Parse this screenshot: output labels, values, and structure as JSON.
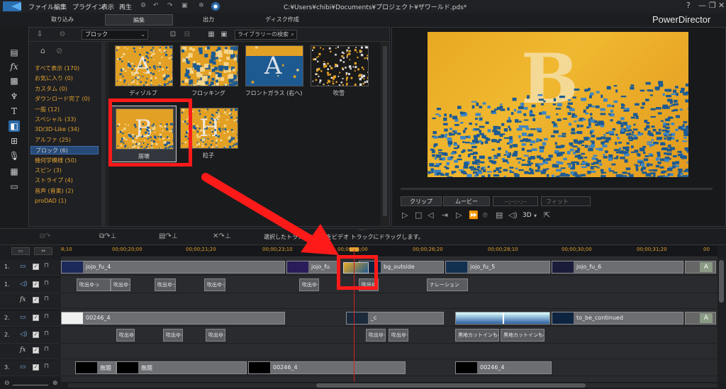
{
  "window": {
    "title": "C:¥Users¥chibi¥Documents¥プロジェクト¥ザワールド.pds*",
    "brand": "PowerDirector",
    "menus": [
      "ファイル",
      "編集",
      "プラグイン",
      "表示",
      "再生"
    ],
    "help": "?",
    "minimize": "—",
    "restore": "❐",
    "close": "✕"
  },
  "tabs": [
    "取り込み",
    "編集",
    "出力",
    "ディスク作成"
  ],
  "active_tab": "編集",
  "library": {
    "category_dropdown": "ブロック",
    "search_placeholder": "ライブラリーの検索",
    "categories": [
      {
        "label": "すべて表示 (170)",
        "selected": false
      },
      {
        "label": "お気に入り (0)",
        "selected": false
      },
      {
        "label": "カスタム (0)",
        "selected": false
      },
      {
        "label": "ダウンロード完了 (0)",
        "selected": false
      },
      {
        "label": "一般 (12)",
        "selected": false
      },
      {
        "label": "スペシャル (33)",
        "selected": false
      },
      {
        "label": "3D/3D-Like (34)",
        "selected": false
      },
      {
        "label": "アルファ (25)",
        "selected": false
      },
      {
        "label": "ブロック (6)",
        "selected": true
      },
      {
        "label": "幾何学模様 (50)",
        "selected": false
      },
      {
        "label": "スピン (3)",
        "selected": false
      },
      {
        "label": "ストライプ (4)",
        "selected": false
      },
      {
        "label": "音声 (音楽) (2)",
        "selected": false
      },
      {
        "label": "proDAD (1)",
        "selected": false
      }
    ],
    "transitions": [
      {
        "label": "ディゾルブ",
        "style": "dissolve",
        "glyph": "A"
      },
      {
        "label": "フロッキング",
        "style": "flocking",
        "glyph": ""
      },
      {
        "label": "フロントガラス (右へ)",
        "style": "windshield",
        "glyph": "A"
      },
      {
        "label": "吹雪",
        "style": "blizzard",
        "glyph": ""
      },
      {
        "label": "崩壊",
        "style": "collapse",
        "glyph": "B"
      },
      {
        "label": "粒子",
        "style": "particle",
        "glyph": "H"
      }
    ],
    "selected_transition": "崩壊"
  },
  "preview": {
    "glyph": "B",
    "clip_tab": "クリップ",
    "movie_tab": "ムービー",
    "timecode": "--;--;--;--",
    "fit": "フィット",
    "mode_3d": "3D"
  },
  "timeline": {
    "hint": "選択したトランジションをビデオ トラックにドラッグします。",
    "ruler_ticks": [
      "8;10",
      "00;00;20;00",
      "00;00;21;20",
      "00;00;23;10",
      "00;00;25;00",
      "00;00;26;20",
      "00;00;28;10",
      "00;00;30;00",
      "00;00;31;20",
      "00"
    ],
    "tracks": [
      {
        "num": "1.",
        "kind": "video"
      },
      {
        "num": "1.",
        "kind": "audio"
      },
      {
        "num": "",
        "kind": "fx"
      },
      {
        "num": "2.",
        "kind": "video"
      },
      {
        "num": "2.",
        "kind": "audio"
      },
      {
        "num": "",
        "kind": "fx"
      },
      {
        "num": "3.",
        "kind": "video"
      }
    ],
    "v1_clips": [
      "jojo_fu_4",
      "jojo_fu",
      "bg_outside",
      "jojo_fu_5",
      "jojo_fu_6"
    ],
    "a1_clips": [
      "吹出ゆっ",
      "吹出ゆっ",
      "吹出ゆっ",
      "吹出ゆっ",
      "吹出ゆっ",
      "吹出ゆっ",
      "ナレーション"
    ],
    "v2_clips": [
      "00246_4",
      "_c",
      "to_be_continued"
    ],
    "a2_clips": [
      "吹出ゆっ",
      "吹出ゆっ",
      "吹出ゆっ",
      "吹出ゆっ",
      "吹出ゆっ",
      "黒地カットインもの",
      "黒地カットインもの"
    ],
    "v3_clips": [
      "無題",
      "無題",
      "00246_4",
      "00246_4"
    ],
    "title_glyph": "A"
  },
  "colors": {
    "accent_orange": "#e0a030",
    "selection_blue": "#284a78",
    "annotation_red": "#ff1a1a",
    "playhead_red": "#d02020"
  }
}
